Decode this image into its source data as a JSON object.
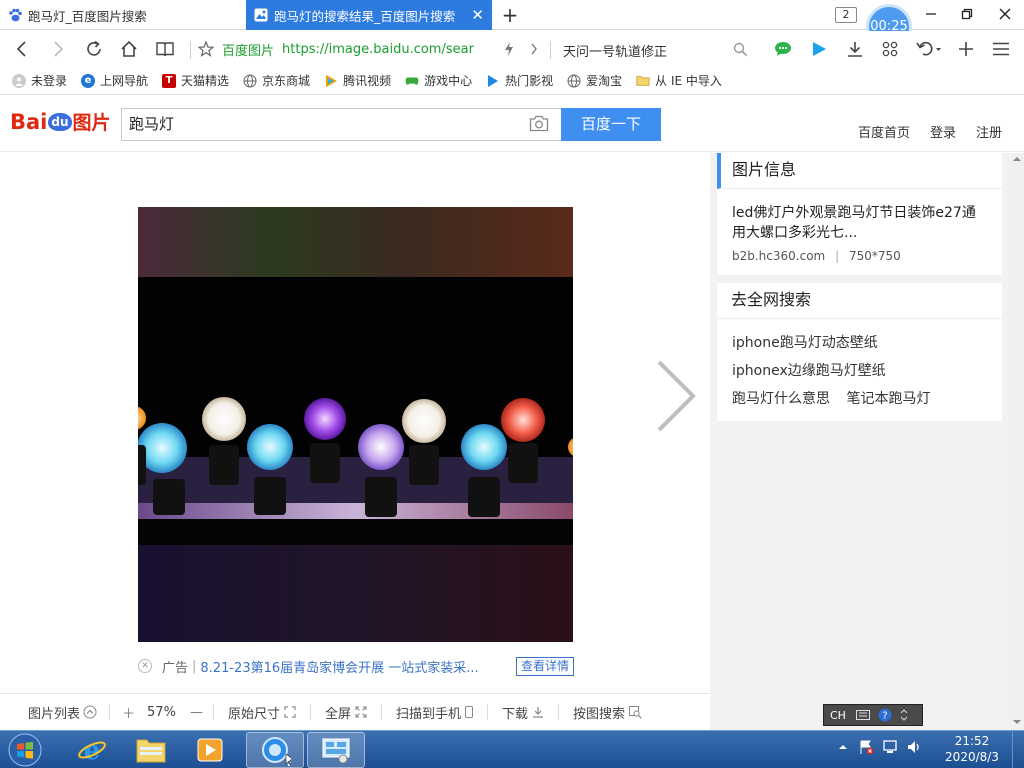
{
  "tabs": [
    {
      "title": "跑马灯_百度图片搜索"
    },
    {
      "title": "跑马灯的搜索结果_百度图片搜索",
      "close": "✕"
    }
  ],
  "tab_count": "2",
  "timer": "00:25",
  "toolbar": {
    "site_label": "百度图片",
    "url": "https://image.baidu.com/sear",
    "suggestion": "天问一号轨道修正"
  },
  "bookmarks": [
    {
      "label": "未登录",
      "icon": "user-icon"
    },
    {
      "label": "上网导航",
      "icon": "ie-icon"
    },
    {
      "label": "天猫精选",
      "icon": "tmall-icon"
    },
    {
      "label": "京东商城",
      "icon": "globe-icon"
    },
    {
      "label": "腾讯视频",
      "icon": "tencent-video-icon"
    },
    {
      "label": "游戏中心",
      "icon": "gamepad-icon"
    },
    {
      "label": "热门影视",
      "icon": "play-icon"
    },
    {
      "label": "爱淘宝",
      "icon": "globe-icon"
    },
    {
      "label": "从 IE 中导入",
      "icon": "folder-icon"
    }
  ],
  "header": {
    "logo_bai": "Bai",
    "logo_du": "du",
    "logo_pic": "图片",
    "search_value": "跑马灯",
    "search_button": "百度一下",
    "links": [
      "百度首页",
      "登录",
      "注册"
    ]
  },
  "ad": {
    "tag": "广告",
    "bar": "|",
    "text": "8.21-23第16届青岛家博会开展 一站式家装采...",
    "button": "查看详情"
  },
  "bottombar": {
    "list": "图片列表",
    "zoom_in": "＋",
    "zoom": "57%",
    "zoom_out": "—",
    "original": "原始尺寸",
    "fullscreen": "全屏",
    "scan": "扫描到手机",
    "download": "下载",
    "search_by_image": "按图搜索"
  },
  "info_card": {
    "title": "图片信息",
    "description": "led佛灯户外观景跑马灯节日装饰e27通用大螺口多彩光七...",
    "source": "b2b.hc360.com",
    "divider": "|",
    "size": "750*750"
  },
  "related_card": {
    "title": "去全网搜索",
    "items": [
      "iphone跑马灯动态壁纸",
      "iphonex边缘跑马灯壁纸",
      "跑马灯什么意思",
      "笔记本跑马灯"
    ]
  },
  "ime": {
    "label": "CH"
  },
  "clock": {
    "time": "21:52",
    "date": "2020/8/3"
  },
  "colors": {
    "accent": "#3e8ff0",
    "tab_active": "#2e7be0",
    "url_green": "#1a9e2e",
    "brand_red": "#de2910"
  }
}
